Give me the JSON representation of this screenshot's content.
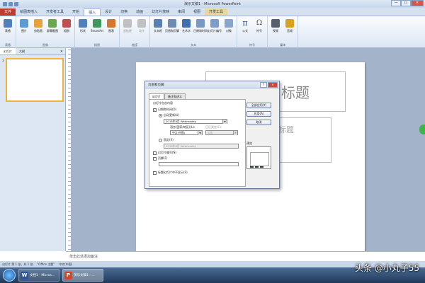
{
  "window": {
    "title": "演示文稿1 - Microsoft PowerPoint",
    "minimize": "—",
    "maximize": "□",
    "close": "✕"
  },
  "tabs": [
    {
      "label": "文件",
      "kind": "file"
    },
    {
      "label": "绘图表插入",
      "kind": ""
    },
    {
      "label": "开发者工具",
      "kind": ""
    },
    {
      "label": "开始",
      "kind": ""
    },
    {
      "label": "插入",
      "kind": "active"
    },
    {
      "label": "设计",
      "kind": ""
    },
    {
      "label": "切换",
      "kind": ""
    },
    {
      "label": "动画",
      "kind": ""
    },
    {
      "label": "幻灯片放映",
      "kind": ""
    },
    {
      "label": "审阅",
      "kind": ""
    },
    {
      "label": "视图",
      "kind": ""
    },
    {
      "label": "开发工具",
      "kind": "tool"
    }
  ],
  "ribbon": {
    "groups": [
      {
        "label": "表格",
        "buttons": [
          {
            "label": "表格",
            "color": "#4f7fbf",
            "dim": false
          }
        ]
      },
      {
        "label": "图像",
        "buttons": [
          {
            "label": "图片",
            "color": "#5b9bd5",
            "dim": false
          },
          {
            "label": "剪贴画",
            "color": "#e8a23a",
            "dim": false
          },
          {
            "label": "屏幕截图",
            "color": "#6aa84f",
            "dim": false
          },
          {
            "label": "相册",
            "color": "#c0504d",
            "dim": false
          }
        ]
      },
      {
        "label": "插图",
        "buttons": [
          {
            "label": "形状",
            "color": "#4f81bd",
            "dim": false
          },
          {
            "label": "SmartArt",
            "color": "#3c9a5e",
            "dim": false
          },
          {
            "label": "图表",
            "color": "#d4772c",
            "dim": false
          }
        ]
      },
      {
        "label": "链接",
        "buttons": [
          {
            "label": "超链接",
            "color": "#7f7f7f",
            "dim": true
          },
          {
            "label": "动作",
            "color": "#7f7f7f",
            "dim": true
          }
        ]
      },
      {
        "label": "文本",
        "buttons": [
          {
            "label": "文本框",
            "color": "#5a7fb5",
            "dim": false
          },
          {
            "label": "页眉和页脚",
            "color": "#6f8db3",
            "dim": false
          },
          {
            "label": "艺术字",
            "color": "#3f6fb0",
            "dim": false
          },
          {
            "label": "日期和时间",
            "color": "#7a98c4",
            "dim": false
          },
          {
            "label": "幻灯片编号",
            "color": "#7d9cc8",
            "dim": false
          },
          {
            "label": "对象",
            "color": "#8aa5cc",
            "dim": false
          }
        ]
      },
      {
        "label": "符号",
        "buttons": [
          {
            "label": "公式",
            "symbol": "π",
            "dim": false
          },
          {
            "label": "符号",
            "symbol": "Ω",
            "dim": false
          }
        ]
      },
      {
        "label": "媒体",
        "buttons": [
          {
            "label": "视频",
            "color": "#555f6e",
            "dim": false
          },
          {
            "label": "音频",
            "color": "#d9a21c",
            "dim": false
          }
        ]
      }
    ]
  },
  "left_panel": {
    "tabs": [
      "幻灯片",
      "大纲"
    ],
    "close": "×",
    "slide_number": "1"
  },
  "slide": {
    "title_placeholder": "标题",
    "subtitle_placeholder": "标题"
  },
  "dialog": {
    "title": "页眉和页脚",
    "help_button": "?",
    "close_button": "✕",
    "tabs": [
      "幻灯片",
      "备注和讲义"
    ],
    "section_label": "幻灯片包含内容",
    "date_time_checkbox": "日期和时间(D)",
    "auto_update_radio": "自动更新(U)",
    "date_value": "2018年8月 Wednesday",
    "language_label": "语言(国家/地区)(L):",
    "calendar_label": "日历类型(C):",
    "language_value": "中文(中国)",
    "calendar_value": "公历",
    "fixed_radio": "固定(X)",
    "fixed_value": "2018年8月 Wednesday",
    "slide_number_checkbox": "幻灯片编号(N)",
    "footer_checkbox": "页脚(F)",
    "hide_on_title_checkbox": "标题幻灯片中不显示(S)",
    "apply_all_button": "全部应用(Y)",
    "apply_button": "应用(A)",
    "cancel_button": "取消",
    "preview_label": "预览"
  },
  "notes": {
    "placeholder": "单击此处添加备注"
  },
  "status": {
    "slide_info": "幻灯片 第 1 张，共 1 张",
    "theme": "\"Office 主题\"",
    "language": "中文(中国)",
    "zoom": ""
  },
  "taskbar": {
    "tasks": [
      {
        "label": "文档1 - Micros...",
        "icon": "W",
        "color": "#2b579a"
      },
      {
        "label": "演示文稿1 - ...",
        "icon": "P",
        "color": "#d24726"
      }
    ]
  },
  "watermark": "头条 @小丸子55"
}
